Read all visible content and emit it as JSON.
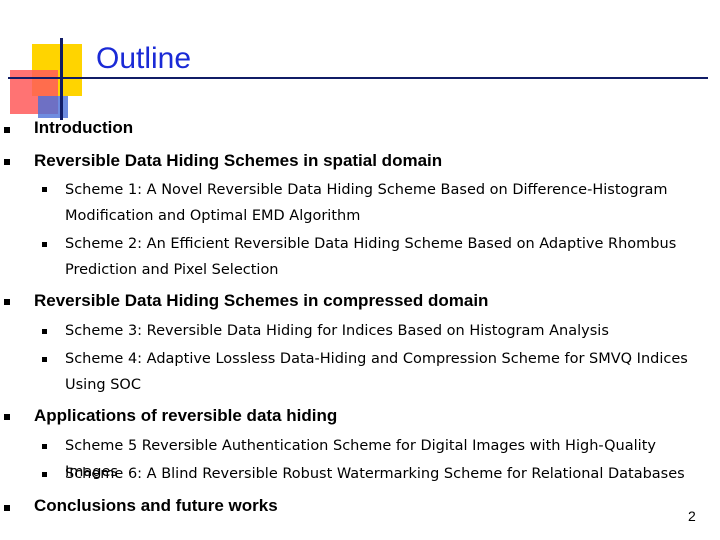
{
  "title": "Outline",
  "page_number": "2",
  "sections": [
    {
      "label": "Introduction"
    },
    {
      "label": "Reversible Data Hiding Schemes in spatial domain"
    },
    {
      "label": "Reversible Data Hiding Schemes in compressed domain"
    },
    {
      "label": "Applications of reversible data hiding"
    },
    {
      "label": "Conclusions and future works"
    }
  ],
  "schemes": [
    {
      "name": "Scheme 1:",
      "text": " A Novel Reversible Data Hiding Scheme Based on Difference-Histogram Modification and Optimal EMD Algorithm"
    },
    {
      "name": "Scheme 2:",
      "text": " An Efficient Reversible Data Hiding Scheme Based on Adaptive Rhombus Prediction and Pixel Selection"
    },
    {
      "name": "Scheme 3",
      "text": ": Reversible Data Hiding for Indices Based on Histogram Analysis"
    },
    {
      "name": "Scheme 4:",
      "text": " Adaptive Lossless Data-Hiding and Compression Scheme for SMVQ Indices Using SOC"
    },
    {
      "name": "Scheme 5",
      "text": " Reversible Authentication Scheme for Digital Images with High-Quality Images"
    },
    {
      "name": "Scheme 6:",
      "text": " A Blind Reversible Robust Watermarking Scheme for Relational Databases"
    }
  ]
}
